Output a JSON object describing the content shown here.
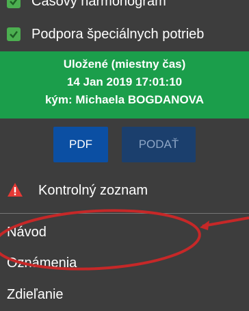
{
  "items": [
    {
      "label": "Časový harmonogram"
    },
    {
      "label": "Podpora špeciálnych potrieb"
    }
  ],
  "status": {
    "line1": "Uložené (miestny čas)",
    "line2": "14 Jan 2019 17:01:10",
    "line3": "kým: Michaela BOGDANOVA"
  },
  "buttons": {
    "pdf": "PDF",
    "submit": "PODAŤ"
  },
  "checklist": {
    "label": "Kontrolný zoznam"
  },
  "menu": [
    "Návod",
    "Oznámenia",
    "Zdieľanie"
  ],
  "colors": {
    "background": "#3d3d3d",
    "status_green": "#1b9e4b",
    "button_blue": "#0b4fa3",
    "check_green": "#4caf50",
    "warning_red": "#e53935",
    "annotation_red": "#c62828"
  }
}
